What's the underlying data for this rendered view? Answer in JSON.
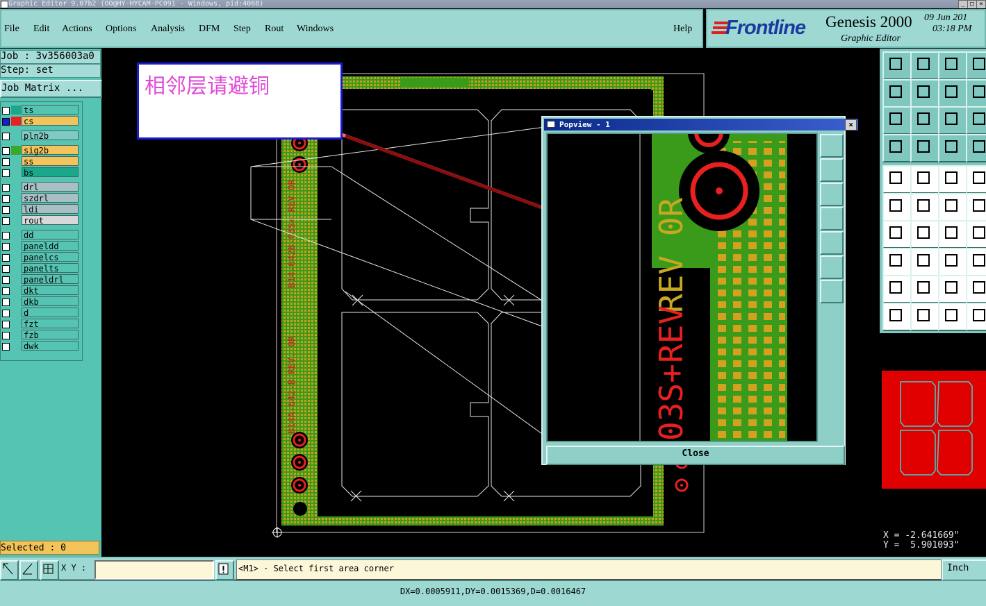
{
  "window": {
    "title": "Graphic Editor 9.07b2 (OO@HY-HYCAM-PC091 - Windows, pid:4068)",
    "controls": [
      "_",
      "□",
      "×"
    ]
  },
  "menu": {
    "items": [
      "File",
      "Edit",
      "Actions",
      "Options",
      "Analysis",
      "DFM",
      "Step",
      "Rout",
      "Windows"
    ],
    "help": "Help"
  },
  "brand": {
    "logo": "Frontline",
    "product": "Genesis 2000",
    "subtitle": "Graphic Editor",
    "date": "09 Jun 201",
    "time": "03:18 PM"
  },
  "job": {
    "job_label": "Job : 3v356003a0",
    "step_label": "Step: set",
    "matrix_button": "Job Matrix ..."
  },
  "layers": [
    {
      "name": "ts",
      "color": "#1aa88a",
      "fill": "#56c4b3",
      "checked": false
    },
    {
      "name": "cs",
      "color": "#e82020",
      "fill": "#f2c45a",
      "checked": true
    },
    {
      "name": "pln2b",
      "color": "",
      "fill": "#7fcac2",
      "checked": false
    },
    {
      "name": "sig2b",
      "color": "#3aa82a",
      "fill": "#f2c45a",
      "checked": false
    },
    {
      "name": "ss",
      "color": "",
      "fill": "#f2c45a",
      "checked": false
    },
    {
      "name": "bs",
      "color": "",
      "fill": "#1aa88a",
      "checked": false
    },
    {
      "name": "drl",
      "color": "",
      "fill": "#a8c0c4",
      "checked": false
    },
    {
      "name": "szdrl",
      "color": "",
      "fill": "#a8c0c4",
      "checked": false
    },
    {
      "name": "ldi",
      "color": "",
      "fill": "#a8c0c4",
      "checked": false
    },
    {
      "name": "rout",
      "color": "",
      "fill": "#d8d8d8",
      "checked": false
    },
    {
      "name": "dd",
      "color": "",
      "fill": "#56c4b3",
      "checked": false
    },
    {
      "name": "paneldd",
      "color": "",
      "fill": "#56c4b3",
      "checked": false
    },
    {
      "name": "panelcs",
      "color": "",
      "fill": "#56c4b3",
      "checked": false
    },
    {
      "name": "panelts",
      "color": "",
      "fill": "#56c4b3",
      "checked": false
    },
    {
      "name": "paneldrl",
      "color": "",
      "fill": "#56c4b3",
      "checked": false
    },
    {
      "name": "dkt",
      "color": "",
      "fill": "#56c4b3",
      "checked": false
    },
    {
      "name": "dkb",
      "color": "",
      "fill": "#56c4b3",
      "checked": false
    },
    {
      "name": "d",
      "color": "",
      "fill": "#56c4b3",
      "checked": false
    },
    {
      "name": "fzt",
      "color": "",
      "fill": "#56c4b3",
      "checked": false
    },
    {
      "name": "fzb",
      "color": "",
      "fill": "#56c4b3",
      "checked": false
    },
    {
      "name": "dwk",
      "color": "",
      "fill": "#56c4b3",
      "checked": false
    }
  ],
  "selected": "Selected : 0",
  "callout": {
    "text": "相邻层请避铜"
  },
  "canvas_labels": {
    "left_text_1": "B14-642B-03S+ REV 0R",
    "left_text_2": "B14A-642-B REV. 0R"
  },
  "popview": {
    "title": "Popview - 1",
    "close_x": "×",
    "close_button": "Close",
    "zoom_text_1": "REV 0R",
    "zoom_text_2": "03S+"
  },
  "coords": {
    "x": "X = -2.641669\"",
    "y": "Y =  5.901093\""
  },
  "command": {
    "xy_label": "X Y :",
    "prompt": "<M1> - Select first area corner",
    "units": "Inch"
  },
  "status": "DX=0.0005911,DY=0.0015369,D=0.0016467",
  "colors": {
    "panel": "#9dd9d2",
    "copper": "#3a9a1a",
    "pad": "#e82020",
    "callout_text": "#e04ad8",
    "callout_border": "#1b1bd0"
  }
}
